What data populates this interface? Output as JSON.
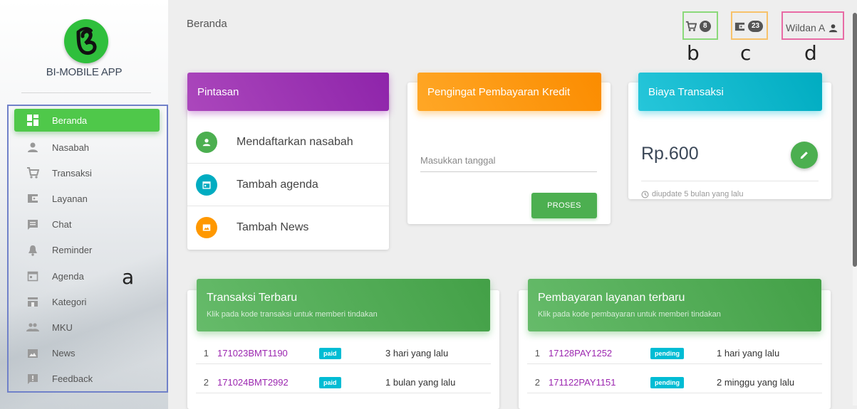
{
  "sidebar": {
    "brand": "BI-MOBILE APP",
    "items": [
      {
        "label": "Beranda",
        "icon": "dashboard-icon",
        "active": true
      },
      {
        "label": "Nasabah",
        "icon": "person-icon"
      },
      {
        "label": "Transaksi",
        "icon": "cart-icon"
      },
      {
        "label": "Layanan",
        "icon": "wallet-icon"
      },
      {
        "label": "Chat",
        "icon": "chat-icon"
      },
      {
        "label": "Reminder",
        "icon": "bell-icon"
      },
      {
        "label": "Agenda",
        "icon": "calendar-icon"
      },
      {
        "label": "Kategori",
        "icon": "category-icon"
      },
      {
        "label": "MKU",
        "icon": "group-icon"
      },
      {
        "label": "News",
        "icon": "image-icon"
      },
      {
        "label": "Feedback",
        "icon": "feedback-icon"
      }
    ]
  },
  "annotations": {
    "a": "a",
    "b": "b",
    "c": "c",
    "d": "d"
  },
  "header": {
    "breadcrumb": "Beranda",
    "cart_count": "8",
    "wallet_count": "23",
    "user_name": "Wildan A"
  },
  "shortcuts": {
    "title": "Pintasan",
    "items": [
      {
        "label": "Mendaftarkan nasabah",
        "color": "#4caf50",
        "icon": "person-icon"
      },
      {
        "label": "Tambah agenda",
        "color": "#00acc1",
        "icon": "calendar-icon"
      },
      {
        "label": "Tambah News",
        "color": "#ff9800",
        "icon": "image-icon"
      }
    ]
  },
  "reminder": {
    "title": "Pengingat Pembayaran Kredit",
    "date_placeholder": "Masukkan tanggal",
    "submit_label": "PROSES"
  },
  "fee": {
    "title": "Biaya Transaksi",
    "amount": "Rp.600",
    "updated": "diupdate 5 bulan yang lalu"
  },
  "transactions": {
    "title": "Transaksi Terbaru",
    "subtitle": "Klik pada kode transaksi untuk memberi tindakan",
    "rows": [
      {
        "no": "1",
        "code": "171023BMT1190",
        "status": "paid",
        "time": "3 hari yang lalu"
      },
      {
        "no": "2",
        "code": "171024BMT2992",
        "status": "paid",
        "time": "1 bulan yang lalu"
      }
    ]
  },
  "payments": {
    "title": "Pembayaran layanan terbaru",
    "subtitle": "Klik pada kode pembayaran untuk memberi tindakan",
    "rows": [
      {
        "no": "1",
        "code": "17128PAY1252",
        "status": "pending",
        "time": "1 hari yang lalu"
      },
      {
        "no": "2",
        "code": "171122PAY1151",
        "status": "pending",
        "time": "2 minggu yang lalu"
      }
    ]
  },
  "colors": {
    "accent_green": "#4caf50",
    "purple": "#9c27b0",
    "orange": "#ff9800",
    "cyan": "#00bcd4",
    "box_blue": "#7081c9",
    "box_green": "#8bd97a",
    "box_orange": "#f7c26b",
    "box_pink": "#e86ba5"
  }
}
